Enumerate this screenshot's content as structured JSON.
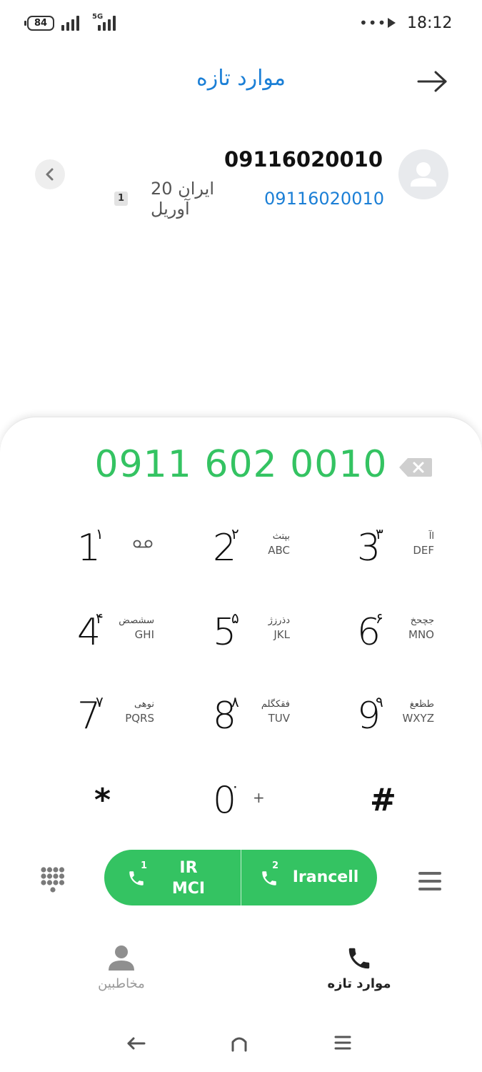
{
  "status_bar": {
    "battery": "84",
    "network_type": "5G",
    "dots": "•••",
    "time": "18:12"
  },
  "header": {
    "title": "موارد تازه"
  },
  "recent_item": {
    "name": "09116020010",
    "number": "09116020010",
    "info": "ایران 20 آوریل",
    "sim": "1"
  },
  "dialer": {
    "number": "0911 602 0010",
    "keys": [
      {
        "digit": "1",
        "persian": "۱",
        "fa": "",
        "en": "",
        "voicemail": true
      },
      {
        "digit": "2",
        "persian": "۲",
        "fa": "بپتث",
        "en": "ABC"
      },
      {
        "digit": "3",
        "persian": "۳",
        "fa": "اآ",
        "en": "DEF"
      },
      {
        "digit": "4",
        "persian": "۴",
        "fa": "سشصض",
        "en": "GHI"
      },
      {
        "digit": "5",
        "persian": "۵",
        "fa": "دذرزژ",
        "en": "JKL"
      },
      {
        "digit": "6",
        "persian": "۶",
        "fa": "جچحخ",
        "en": "MNO"
      },
      {
        "digit": "7",
        "persian": "۷",
        "fa": "نوهی",
        "en": "PQRS"
      },
      {
        "digit": "8",
        "persian": "۸",
        "fa": "فقکگلم",
        "en": "TUV"
      },
      {
        "digit": "9",
        "persian": "۹",
        "fa": "طظعغ",
        "en": "WXYZ"
      },
      {
        "digit": "*",
        "persian": "",
        "fa": "",
        "en": ""
      },
      {
        "digit": "0",
        "persian": "۰",
        "fa": "",
        "en": "+"
      },
      {
        "digit": "#",
        "persian": "",
        "fa": "",
        "en": ""
      }
    ]
  },
  "call_buttons": {
    "sim1_number": "1",
    "sim1_label_line1": "IR",
    "sim1_label_line2": "MCI",
    "sim2_number": "2",
    "sim2_label": "Irancell"
  },
  "bottom_nav": {
    "contacts_label": "مخاطبین",
    "recents_label": "موارد تازه"
  },
  "colors": {
    "accent_blue": "#1b7fd6",
    "call_green": "#34c362",
    "dial_number_green": "#34c362"
  }
}
